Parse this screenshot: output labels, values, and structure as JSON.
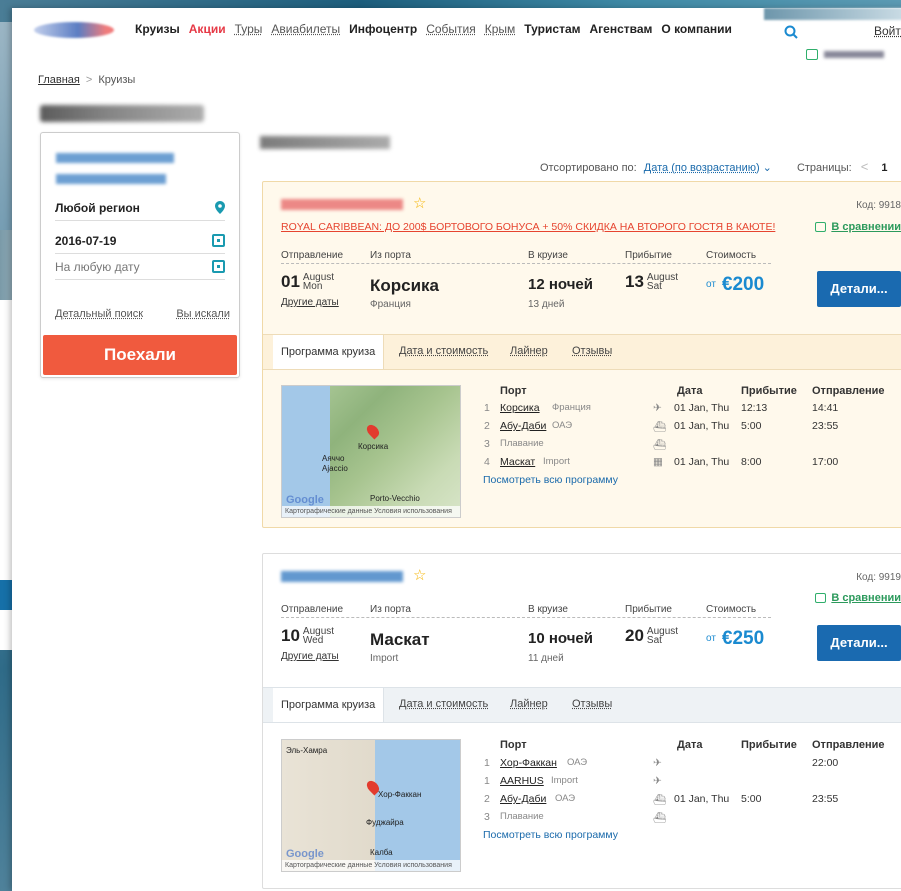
{
  "header": {
    "nav": [
      "Круизы",
      "Акции",
      "Туры",
      "Авиабилеты",
      "Инфоцентр",
      "События",
      "Крым",
      "Туристам",
      "Агенствам",
      "О компании"
    ],
    "login": "Войти"
  },
  "breadcrumb": {
    "home": "Главная",
    "sep": ">",
    "current": "Круизы"
  },
  "sidebar": {
    "region": "Любой регион",
    "date_from": "2016-07-19",
    "date_to_placeholder": "На любую дату",
    "detailed_search": "Детальный поиск",
    "you_searched": "Вы искали",
    "go_button": "Поехали"
  },
  "sort": {
    "label": "Отсортировано по:",
    "value": "Дата (по возрастанию)",
    "pages_label": "Страницы:",
    "page": "1"
  },
  "labels": {
    "departure": "Отправление",
    "from_port": "Из порта",
    "cruise": "В круизе",
    "arrival": "Прибытие",
    "cost": "Стоимость",
    "other_dates": "Другие даты",
    "details": "Детали...",
    "comparison": "В сравнении",
    "from": "от",
    "tab_program": "Программа круиза",
    "tab_dates": "Дата и стоимость",
    "tab_liner": "Лайнер",
    "tab_reviews": "Отзывы",
    "col_port": "Порт",
    "col_date": "Дата",
    "col_arrival": "Прибытие",
    "col_departure": "Отправление",
    "see_all": "Посмотреть всю программу"
  },
  "cards": [
    {
      "code": "Код: 9918",
      "promo": "ROYAL CARIBBEAN: ДО 200$ БОРТОВОГО БОНУСА + 50% СКИДКА НА ВТОРОГО ГОСТЯ В КАЮТЕ!",
      "dep_day": "01",
      "dep_month": "August",
      "dep_wd": "Mon",
      "port": "Корсика",
      "country": "Франция",
      "nights": "12 ночей",
      "days": "13 дней",
      "arr_day": "13",
      "arr_month": "August",
      "arr_wd": "Sat",
      "price": "€200",
      "map_labels": [
        "Корсика",
        "Аяччо",
        "Ajaccio",
        "Porto-Vecchio"
      ],
      "map_footer": "Картографические данные  Условия использования",
      "stops": [
        {
          "n": "1",
          "port": "Корсика",
          "country": "Франция",
          "date": "01 Jan, Thu",
          "arr": "12:13",
          "dep": "14:41"
        },
        {
          "n": "2",
          "port": "Абу-Даби",
          "country": "ОАЭ",
          "date": "01 Jan, Thu",
          "arr": "5:00",
          "dep": "23:55"
        },
        {
          "n": "3",
          "port": "",
          "country": "Плавание",
          "date": "",
          "arr": "",
          "dep": ""
        },
        {
          "n": "4",
          "port": "Маскат",
          "country": "Import",
          "date": "01 Jan, Thu",
          "arr": "8:00",
          "dep": "17:00"
        }
      ]
    },
    {
      "code": "Код: 9919",
      "dep_day": "10",
      "dep_month": "August",
      "dep_wd": "Wed",
      "port": "Маскат",
      "country": "Import",
      "nights": "10 ночей",
      "days": "11 дней",
      "arr_day": "20",
      "arr_month": "August",
      "arr_wd": "Sat",
      "price": "€250",
      "map_labels": [
        "Хор-Факкан",
        "Фуджайра",
        "Калба",
        "Эль-Хамра"
      ],
      "map_footer": "Картографические данные  Условия использования",
      "stops": [
        {
          "n": "1",
          "port": "Хор-Факкан",
          "country": "ОАЭ",
          "date": "",
          "arr": "",
          "dep": "22:00"
        },
        {
          "n": "1",
          "port": "AARHUS",
          "country": "Import",
          "date": "",
          "arr": "",
          "dep": ""
        },
        {
          "n": "2",
          "port": "Абу-Даби",
          "country": "ОАЭ",
          "date": "01 Jan, Thu",
          "arr": "5:00",
          "dep": "23:55"
        },
        {
          "n": "3",
          "port": "",
          "country": "Плавание",
          "date": "",
          "arr": "",
          "dep": ""
        }
      ]
    }
  ],
  "colors": {
    "accent": "#1a6ab0",
    "go": "#f05a3e",
    "promo": "#e6442f",
    "price": "#1a8ad0",
    "compare": "#2c9a5c"
  }
}
